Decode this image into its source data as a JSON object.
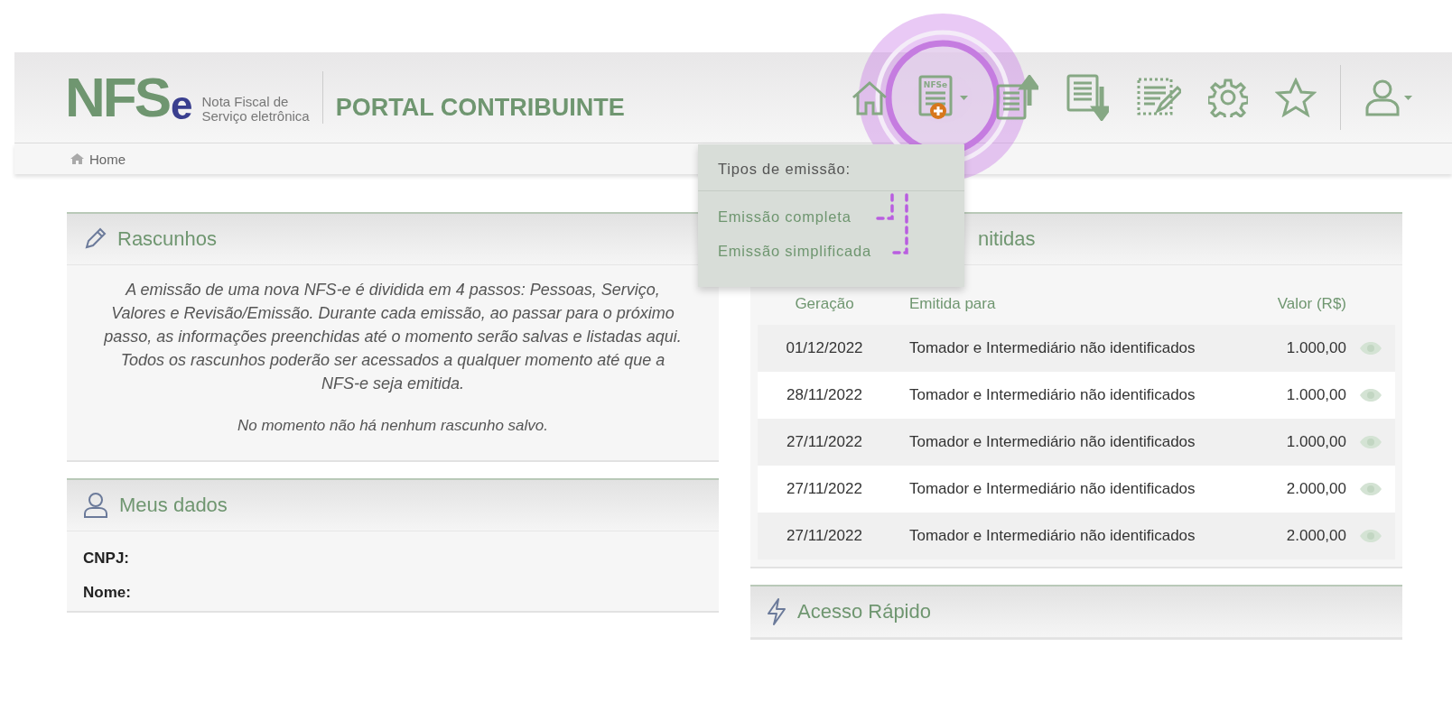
{
  "header": {
    "logo": {
      "letters": "NFS",
      "tail": "e",
      "tagline": [
        "Nota Fiscal de",
        "Serviço eletrônica"
      ]
    },
    "title": "PORTAL CONTRIBUINTE",
    "nav": [
      {
        "kind": "home",
        "caret": false,
        "highlighted": false
      },
      {
        "kind": "new-invoice",
        "label": "NFSe",
        "caret": true,
        "highlighted": true
      },
      {
        "kind": "upload",
        "caret": false,
        "highlighted": false
      },
      {
        "kind": "download",
        "caret": false,
        "highlighted": false
      },
      {
        "kind": "edit",
        "caret": false,
        "highlighted": false
      },
      {
        "kind": "settings",
        "caret": false,
        "highlighted": false
      },
      {
        "kind": "star",
        "caret": false,
        "highlighted": false
      },
      {
        "kind": "user",
        "caret": true,
        "highlighted": false
      }
    ]
  },
  "breadcrumb": {
    "label": "Home"
  },
  "dropdown": {
    "heading": "Tipos de emissão:",
    "items": [
      "Emissão completa",
      "Emissão simplificada"
    ]
  },
  "rascunhos": {
    "title": "Rascunhos",
    "text": "A emissão de uma nova NFS-e é dividida em 4 passos: Pessoas, Serviço, Valores e Revisão/Emissão. Durante cada emissão, ao passar para o próximo passo, as informações preenchidas até o momento serão salvas e listadas aqui. Todos os rascunhos poderão ser acessados a qualquer momento até que a NFS-e seja emitida.",
    "empty": "No momento não há nenhum rascunho salvo."
  },
  "meus_dados": {
    "title": "Meus dados",
    "fields": [
      "CNPJ:",
      "Nome:"
    ]
  },
  "emitidas": {
    "title": "nitidas",
    "columns": [
      "Geração",
      "Emitida para",
      "Valor (R$)"
    ],
    "rows": [
      {
        "date": "01/12/2022",
        "to": "Tomador e Intermediário não identificados",
        "value": "1.000,00"
      },
      {
        "date": "28/11/2022",
        "to": "Tomador e Intermediário não identificados",
        "value": "1.000,00"
      },
      {
        "date": "27/11/2022",
        "to": "Tomador e Intermediário não identificados",
        "value": "1.000,00"
      },
      {
        "date": "27/11/2022",
        "to": "Tomador e Intermediário não identificados",
        "value": "2.000,00"
      },
      {
        "date": "27/11/2022",
        "to": "Tomador e Intermediário não identificados",
        "value": "2.000,00"
      }
    ]
  },
  "acesso": {
    "title": "Acesso Rápido"
  }
}
